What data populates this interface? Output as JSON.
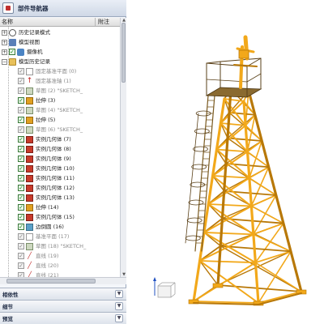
{
  "navigator": {
    "title": "部件导航器",
    "columns": {
      "name": "名称",
      "note": "附注"
    },
    "items": [
      {
        "label": "历史记录模式",
        "indent": 0,
        "icon": "clock-icon",
        "dim": false
      },
      {
        "label": "模型视图",
        "indent": 0,
        "icon": "views-icon",
        "dim": false
      },
      {
        "label": "摄像机",
        "indent": 0,
        "icon": "camera-icon",
        "dim": false
      },
      {
        "label": "模型历史记录",
        "indent": 0,
        "icon": "folder-icon",
        "dim": false
      },
      {
        "label": "固定基准平面 (0)",
        "indent": 1,
        "icon": "datum-plane-icon",
        "dim": true
      },
      {
        "label": "固定基准轴 (1)",
        "indent": 1,
        "icon": "datum-axis-icon",
        "dim": true
      },
      {
        "label": "草图 (2) \"SKETCH_",
        "indent": 1,
        "icon": "sketch-icon",
        "dim": true
      },
      {
        "label": "拉伸 (3)",
        "indent": 1,
        "icon": "extrude-icon",
        "dim": false
      },
      {
        "label": "草图 (4) \"SKETCH_",
        "indent": 1,
        "icon": "sketch-icon",
        "dim": true
      },
      {
        "label": "拉伸 (5)",
        "indent": 1,
        "icon": "extrude-icon",
        "dim": false
      },
      {
        "label": "草图 (6) \"SKETCH_",
        "indent": 1,
        "icon": "sketch-icon",
        "dim": true
      },
      {
        "label": "实例几何体 (7)",
        "indent": 1,
        "icon": "pattern-icon",
        "dim": false
      },
      {
        "label": "实例几何体 (8)",
        "indent": 1,
        "icon": "pattern-icon",
        "dim": false
      },
      {
        "label": "实例几何体 (9)",
        "indent": 1,
        "icon": "pattern-icon",
        "dim": false
      },
      {
        "label": "实例几何体 (10)",
        "indent": 1,
        "icon": "pattern-icon",
        "dim": false
      },
      {
        "label": "实例几何体 (11)",
        "indent": 1,
        "icon": "pattern-icon",
        "dim": false
      },
      {
        "label": "实例几何体 (12)",
        "indent": 1,
        "icon": "pattern-icon",
        "dim": false
      },
      {
        "label": "实例几何体 (13)",
        "indent": 1,
        "icon": "pattern-icon",
        "dim": false
      },
      {
        "label": "拉伸 (14)",
        "indent": 1,
        "icon": "extrude-icon",
        "dim": false
      },
      {
        "label": "实例几何体 (15)",
        "indent": 1,
        "icon": "pattern-icon",
        "dim": false
      },
      {
        "label": "边倒圆 (16)",
        "indent": 1,
        "icon": "edge-blend-icon",
        "dim": false
      },
      {
        "label": "基准平面 (17)",
        "indent": 1,
        "icon": "datum-plane-icon",
        "dim": true
      },
      {
        "label": "草图 (18) \"SKETCH_",
        "indent": 1,
        "icon": "sketch-icon",
        "dim": true
      },
      {
        "label": "直线 (19)",
        "indent": 1,
        "icon": "line-icon",
        "dim": true
      },
      {
        "label": "直线 (20)",
        "indent": 1,
        "icon": "line-icon",
        "dim": true
      },
      {
        "label": "直线 (21)",
        "indent": 1,
        "icon": "line-icon",
        "dim": true
      }
    ],
    "sections": [
      "相依性",
      "细节",
      "预览"
    ]
  },
  "colors": {
    "tower": "#f2a81a",
    "tower_dark": "#b87808",
    "panel_bg": "#f4f6fa"
  }
}
